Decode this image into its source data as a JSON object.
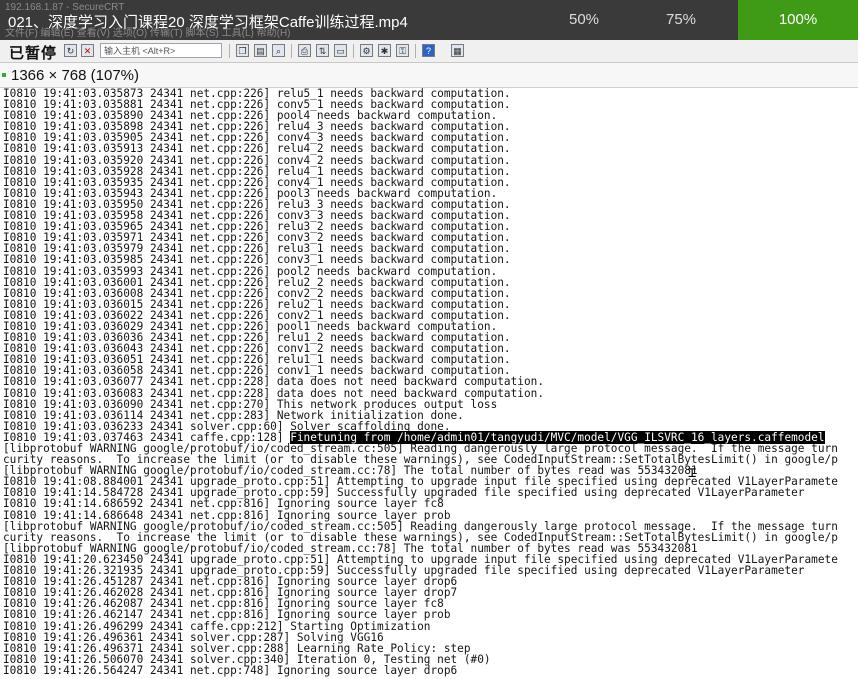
{
  "video": {
    "title": "021、深度学习入门课程20 深度学习框架Caffe训练过程.mp4",
    "ghost_window_title": "192.168.1.87 - SecureCRT",
    "ghost_menu": "文件(F)  编辑(E)  查看(V)  选项(O)  传输(T)  脚本(S)  工具(L)  帮助(H)",
    "speeds": [
      "50%",
      "75%",
      "100%"
    ],
    "active_speed": "100%",
    "accent_color": "#3f9b15"
  },
  "toolbar": {
    "pause_label": "已暂停",
    "host_placeholder": "输入主机 <Alt+R>"
  },
  "resolution": "1366 × 768 (107%)",
  "terminal": {
    "lines": [
      "I0810 19:41:03.035873 24341 net.cpp:226] relu5_1 needs backward computation.",
      "I0810 19:41:03.035881 24341 net.cpp:226] conv5_1 needs backward computation.",
      "I0810 19:41:03.035890 24341 net.cpp:226] pool4 needs backward computation.",
      "I0810 19:41:03.035898 24341 net.cpp:226] relu4_3 needs backward computation.",
      "I0810 19:41:03.035905 24341 net.cpp:226] conv4_3 needs backward computation.",
      "I0810 19:41:03.035913 24341 net.cpp:226] relu4_2 needs backward computation.",
      "I0810 19:41:03.035920 24341 net.cpp:226] conv4_2 needs backward computation.",
      "I0810 19:41:03.035928 24341 net.cpp:226] relu4_1 needs backward computation.",
      "I0810 19:41:03.035935 24341 net.cpp:226] conv4_1 needs backward computation.",
      "I0810 19:41:03.035943 24341 net.cpp:226] pool3 needs backward computation.",
      "I0810 19:41:03.035950 24341 net.cpp:226] relu3_3 needs backward computation.",
      "I0810 19:41:03.035958 24341 net.cpp:226] conv3_3 needs backward computation.",
      "I0810 19:41:03.035965 24341 net.cpp:226] relu3_2 needs backward computation.",
      "I0810 19:41:03.035971 24341 net.cpp:226] conv3_2 needs backward computation.",
      "I0810 19:41:03.035979 24341 net.cpp:226] relu3_1 needs backward computation.",
      "I0810 19:41:03.035985 24341 net.cpp:226] conv3_1 needs backward computation.",
      "I0810 19:41:03.035993 24341 net.cpp:226] pool2 needs backward computation.",
      "I0810 19:41:03.036001 24341 net.cpp:226] relu2_2 needs backward computation.",
      "I0810 19:41:03.036008 24341 net.cpp:226] conv2_2 needs backward computation.",
      "I0810 19:41:03.036015 24341 net.cpp:226] relu2_1 needs backward computation.",
      "I0810 19:41:03.036022 24341 net.cpp:226] conv2_1 needs backward computation.",
      "I0810 19:41:03.036029 24341 net.cpp:226] pool1 needs backward computation.",
      "I0810 19:41:03.036036 24341 net.cpp:226] relu1_2 needs backward computation.",
      "I0810 19:41:03.036043 24341 net.cpp:226] conv1_2 needs backward computation.",
      "I0810 19:41:03.036051 24341 net.cpp:226] relu1_1 needs backward computation.",
      "I0810 19:41:03.036058 24341 net.cpp:226] conv1_1 needs backward computation.",
      "I0810 19:41:03.036077 24341 net.cpp:228] data does not need backward computation.",
      "I0810 19:41:03.036083 24341 net.cpp:228] data does not need backward computation.",
      "I0810 19:41:03.036090 24341 net.cpp:270] This network produces output loss",
      "I0810 19:41:03.036114 24341 net.cpp:283] Network initialization done.",
      "I0810 19:41:03.036233 24341 solver.cpp:60] Solver scaffolding done.",
      {
        "prefix": "I0810 19:41:03.037463 24341 caffe.cpp:128] ",
        "highlight": "Finetuning from /home/admin01/tangyudi/MVC/model/VGG_ILSVRC_16_layers.caffemodel"
      },
      "[libprotobuf WARNING google/protobuf/io/coded_stream.cc:505] Reading dangerously large protocol message.  If the message turn",
      "curity reasons.  To increase the limit (or to disable these warnings), see CodedInputStream::SetTotalBytesLimit() in google/p",
      "[libprotobuf WARNING google/protobuf/io/coded_stream.cc:78] The total number of bytes read was 553432081",
      "I0810 19:41:08.884001 24341 upgrade_proto.cpp:51] Attempting to upgrade input file specified using deprecated V1LayerParamete",
      "I0810 19:41:14.584728 24341 upgrade_proto.cpp:59] Successfully upgraded file specified using deprecated V1LayerParameter",
      "I0810 19:41:14.686592 24341 net.cpp:816] Ignoring source layer fc8",
      "I0810 19:41:14.686648 24341 net.cpp:816] Ignoring source layer prob",
      "[libprotobuf WARNING google/protobuf/io/coded_stream.cc:505] Reading dangerously large protocol message.  If the message turn",
      "curity reasons.  To increase the limit (or to disable these warnings), see CodedInputStream::SetTotalBytesLimit() in google/p",
      "[libprotobuf WARNING google/protobuf/io/coded_stream.cc:78] The total number of bytes read was 553432081",
      "I0810 19:41:20.623450 24341 upgrade_proto.cpp:51] Attempting to upgrade input file specified using deprecated V1LayerParamete",
      "I0810 19:41:26.321935 24341 upgrade_proto.cpp:59] Successfully upgraded file specified using deprecated V1LayerParameter",
      "I0810 19:41:26.451287 24341 net.cpp:816] Ignoring source layer drop6",
      "I0810 19:41:26.462028 24341 net.cpp:816] Ignoring source layer drop7",
      "I0810 19:41:26.462087 24341 net.cpp:816] Ignoring source layer fc8",
      "I0810 19:41:26.462147 24341 net.cpp:816] Ignoring source layer prob",
      "I0810 19:41:26.496299 24341 caffe.cpp:212] Starting Optimization",
      "I0810 19:41:26.496361 24341 solver.cpp:287] Solving VGG16",
      "I0810 19:41:26.496371 24341 solver.cpp:288] Learning Rate Policy: step",
      "I0810 19:41:26.506070 24341 solver.cpp:340] Iteration 0, Testing net (#0)",
      "I0810 19:41:26.564247 24341 net.cpp:748] Ignoring source layer drop6"
    ]
  }
}
